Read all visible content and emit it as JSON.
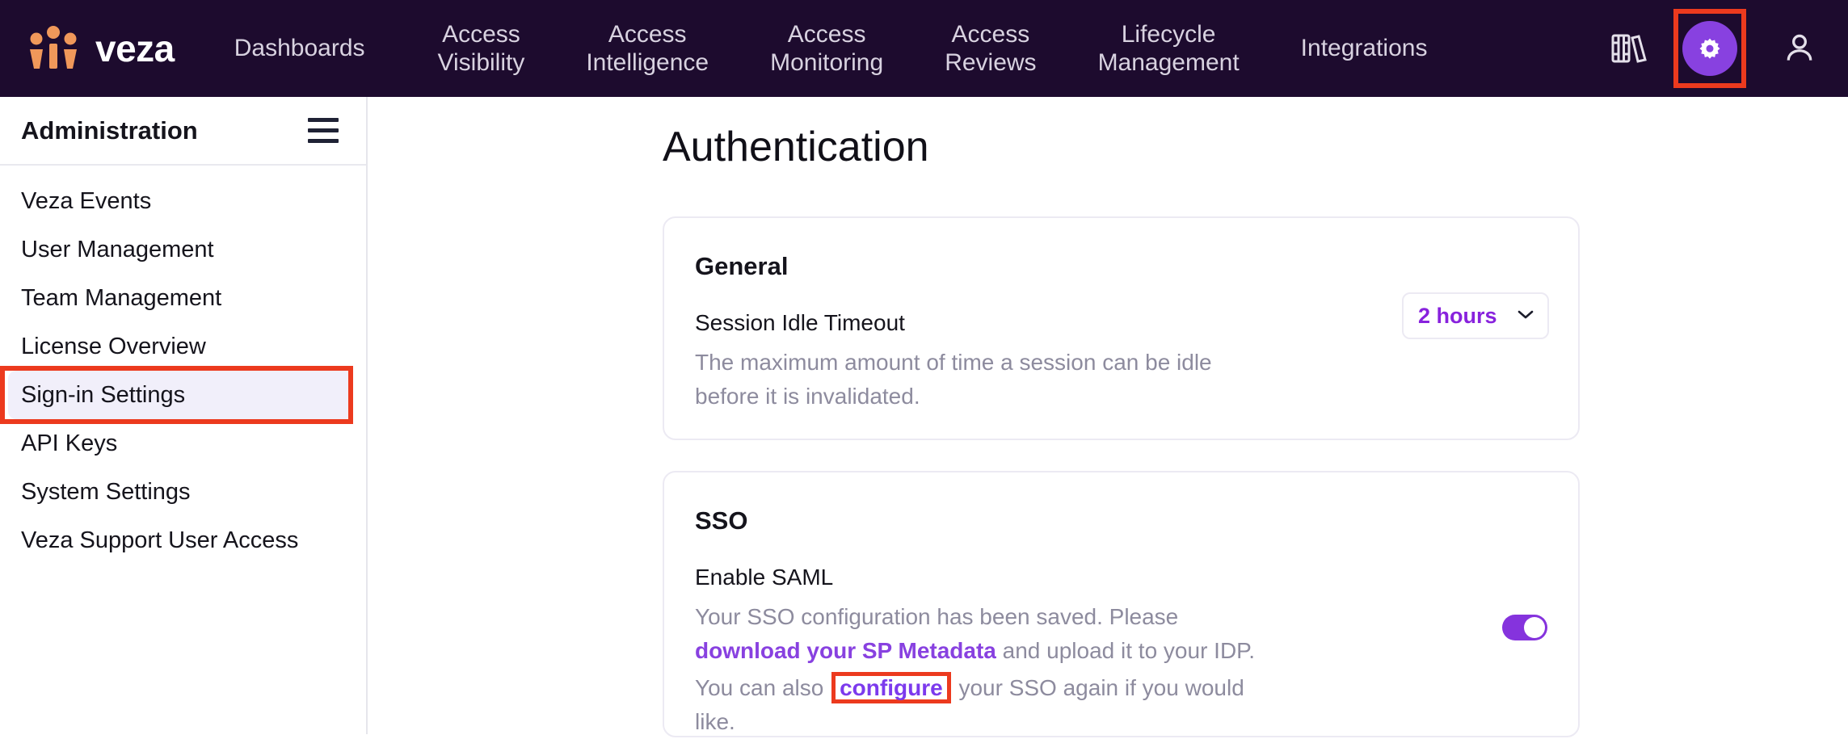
{
  "brand": {
    "name": "veza",
    "logo_icon": "veza-logo-icon",
    "logo_color": "#f0985a"
  },
  "topnav": {
    "items": [
      {
        "label": "Dashboards"
      },
      {
        "label": "Access\nVisibility"
      },
      {
        "label": "Access\nIntelligence"
      },
      {
        "label": "Access\nMonitoring"
      },
      {
        "label": "Access\nReviews"
      },
      {
        "label": "Lifecycle\nManagement"
      },
      {
        "label": "Integrations"
      }
    ],
    "icons": {
      "library": "books-icon",
      "settings": "gear-icon",
      "user": "person-icon"
    },
    "settings_active_color": "#8841e0",
    "highlight_color": "#ec3a1e",
    "background": "#1d0b2e"
  },
  "sidebar": {
    "title": "Administration",
    "menu_icon": "hamburger-menu-icon",
    "items": [
      {
        "label": "Veza Events",
        "active": false
      },
      {
        "label": "User Management",
        "active": false
      },
      {
        "label": "Team Management",
        "active": false
      },
      {
        "label": "License Overview",
        "active": false
      },
      {
        "label": "Sign-in Settings",
        "active": true
      },
      {
        "label": "API Keys",
        "active": false
      },
      {
        "label": "System Settings",
        "active": false
      },
      {
        "label": "Veza Support User Access",
        "active": false
      }
    ],
    "active_bg": "#f1effa"
  },
  "main": {
    "page_title": "Authentication",
    "general": {
      "heading": "General",
      "field_label": "Session Idle Timeout",
      "field_desc": "The maximum amount of time a session can be idle before it is invalidated.",
      "select": {
        "value": "2 hours",
        "chevron_icon": "chevron-down-icon",
        "value_color": "#8822dd"
      }
    },
    "sso": {
      "heading": "SSO",
      "field_label": "Enable SAML",
      "desc_part1": "Your SSO configuration has been saved. Please ",
      "desc_link1": "download your SP Metadata",
      "desc_part2": " and upload it to your IDP.",
      "desc_line2_part1": "You can also ",
      "desc_line2_link": "configure",
      "desc_line2_part2": " your SSO again if you would like.",
      "toggle": {
        "state": "on",
        "color": "#8533dd"
      }
    }
  }
}
